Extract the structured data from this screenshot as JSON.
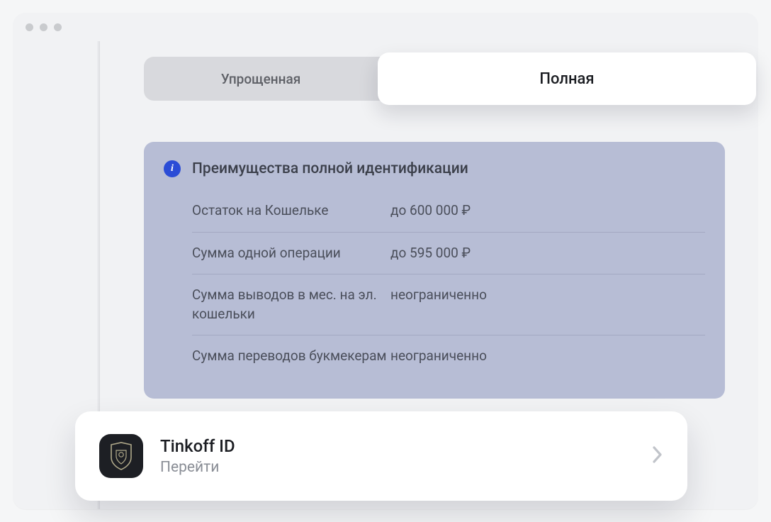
{
  "tabs": {
    "simplified": "Упрощенная",
    "full": "Полная"
  },
  "benefits": {
    "title": "Преимущества полной идентификации",
    "rows": [
      {
        "label": "Остаток на Кошельке",
        "value": "до 600 000 ₽"
      },
      {
        "label": "Сумма одной операции",
        "value": "до 595 000 ₽"
      },
      {
        "label": "Сумма выводов в мес. на эл. кошельки",
        "value": "неограниченно"
      },
      {
        "label": "Сумма переводов букмекерам",
        "value": "неограниченно"
      }
    ]
  },
  "action_card": {
    "title": "Tinkoff ID",
    "subtitle": "Перейти"
  }
}
